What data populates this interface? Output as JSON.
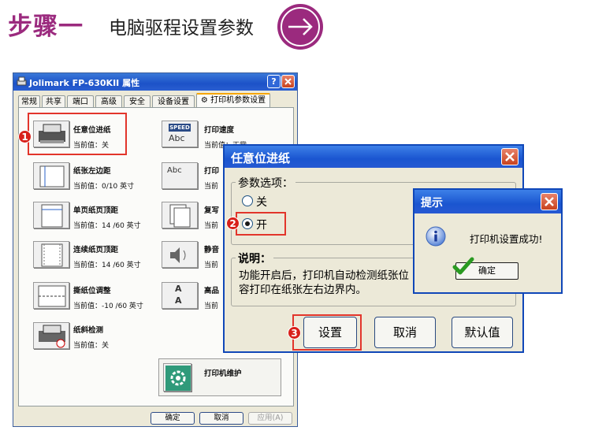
{
  "header": {
    "step": "步骤一",
    "subtitle": "电脑驱程设置参数",
    "arrow_icon": "arrow-right-icon",
    "accent_color": "#9b2a7e"
  },
  "properties_window": {
    "title": "Jolimark FP-630KII 属性",
    "help_label": "?",
    "tabs": [
      "常规",
      "共享",
      "端口",
      "高级",
      "安全",
      "设备设置",
      "打印机参数设置"
    ],
    "items_left": [
      {
        "title": "任意位进纸",
        "value": "当前值：关",
        "icon": "printer-feed-icon"
      },
      {
        "title": "纸张左边距",
        "value": "当前值：0/10 英寸",
        "icon": "left-margin-icon"
      },
      {
        "title": "单页纸页顶距",
        "value": "当前值：14 /60 英寸",
        "icon": "single-sheet-top-icon"
      },
      {
        "title": "连续纸页顶距",
        "value": "当前值：14 /60 英寸",
        "icon": "continuous-paper-top-icon"
      },
      {
        "title": "撕纸位调整",
        "value": "当前值：-10 /60 英寸",
        "icon": "tear-off-icon"
      },
      {
        "title": "纸斜检测",
        "value": "当前值：关",
        "icon": "skew-detect-icon"
      }
    ],
    "items_right": [
      {
        "title": "打印速度",
        "value": "当前值：正常",
        "icon": "speed-icon",
        "icon_text_1": "SPEED",
        "icon_text_2": "Abc"
      },
      {
        "title": "打印",
        "value": "当前",
        "icon": "font-icon",
        "icon_text_1": "Abc"
      },
      {
        "title": "复写",
        "value": "当前",
        "icon": "copy-icon"
      },
      {
        "title": "静音",
        "value": "当前",
        "icon": "mute-icon"
      },
      {
        "title": "高品",
        "value": "当前",
        "icon": "quality-icon",
        "icon_text_1": "A",
        "icon_text_2": "A"
      },
      {
        "title": "打印机维护",
        "value": "",
        "icon": "maintenance-gear-icon"
      }
    ],
    "buttons": {
      "ok": "确定",
      "cancel": "取消",
      "apply": "应用(A)"
    }
  },
  "dialog_feed": {
    "title": "任意位进纸",
    "group_label": "参数选项：",
    "options": [
      {
        "label": "关",
        "selected": false
      },
      {
        "label": "开",
        "selected": true
      }
    ],
    "desc_label": "说明：",
    "desc_line1": "功能开启后，打印机自动检测纸张位",
    "desc_line2": "容打印在纸张左右边界内。",
    "buttons": {
      "set": "设置",
      "cancel": "取消",
      "default": "默认值"
    }
  },
  "dialog_tip": {
    "title": "提示",
    "message": "打印机设置成功!",
    "ok": "确定",
    "info_icon": "info-icon",
    "check_icon": "check-icon"
  },
  "badges": [
    "1",
    "2",
    "3"
  ],
  "badge_color": "#d8201a"
}
